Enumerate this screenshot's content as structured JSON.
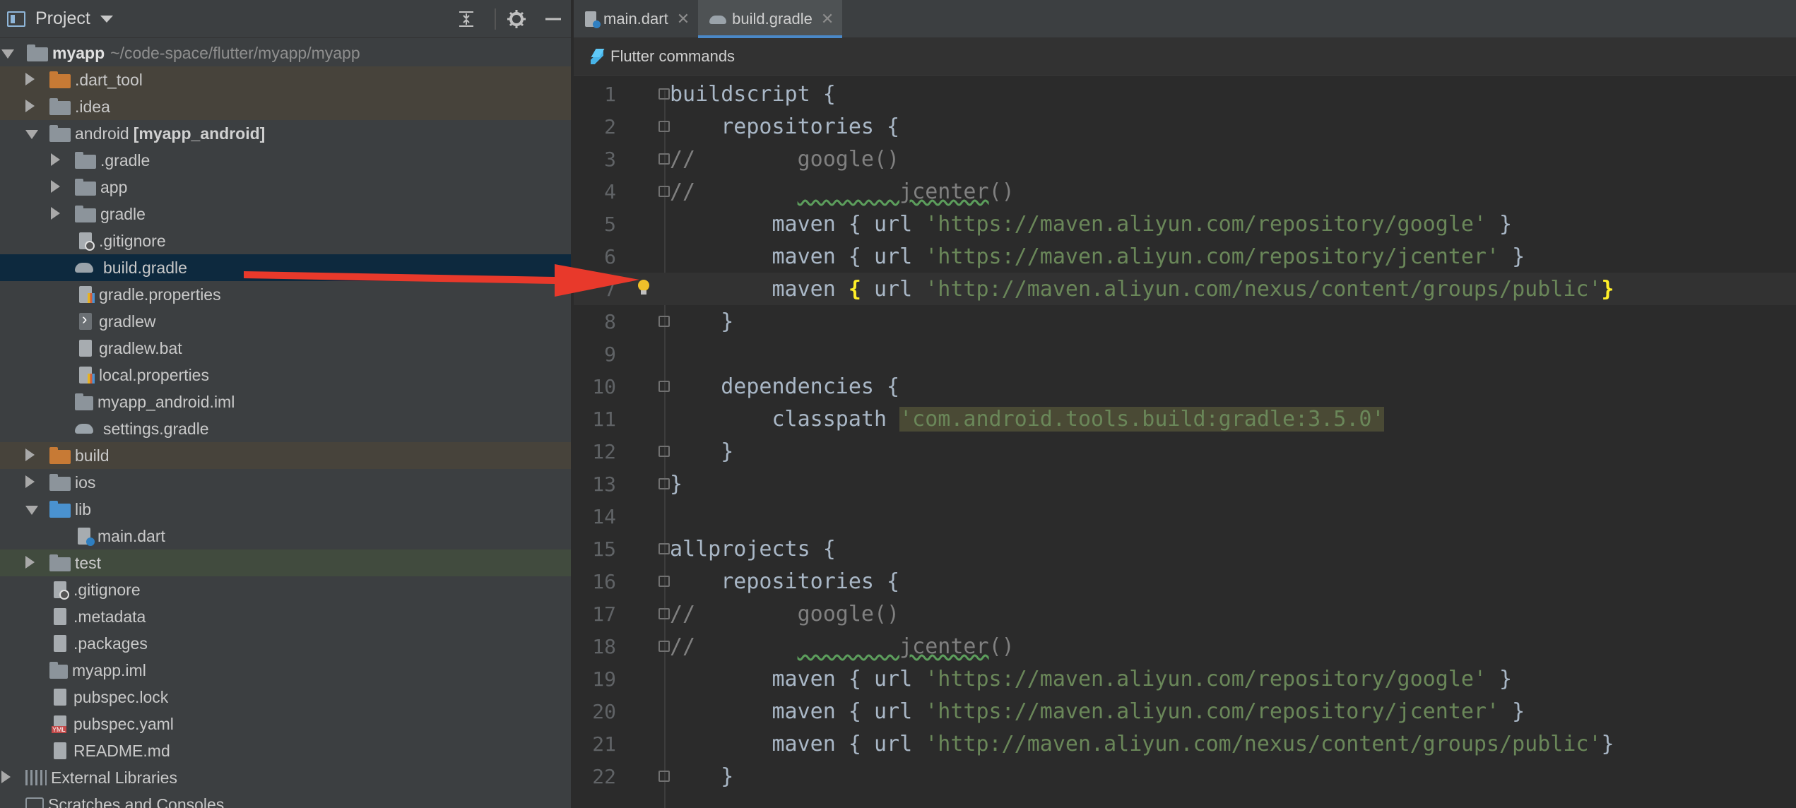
{
  "project_panel": {
    "title": "Project",
    "tree": [
      {
        "label": "myapp",
        "path": "~/code-space/flutter/myapp/myapp",
        "bold": true,
        "expanded": true
      },
      {
        "label": ".dart_tool"
      },
      {
        "label": ".idea"
      },
      {
        "label": "android",
        "module": "[myapp_android]"
      },
      {
        "label": ".gradle"
      },
      {
        "label": "app"
      },
      {
        "label": "gradle"
      },
      {
        "label": ".gitignore"
      },
      {
        "label": "build.gradle"
      },
      {
        "label": "gradle.properties"
      },
      {
        "label": "gradlew"
      },
      {
        "label": "gradlew.bat"
      },
      {
        "label": "local.properties"
      },
      {
        "label": "myapp_android.iml"
      },
      {
        "label": "settings.gradle"
      },
      {
        "label": "build"
      },
      {
        "label": "ios"
      },
      {
        "label": "lib"
      },
      {
        "label": "main.dart"
      },
      {
        "label": "test"
      },
      {
        "label": ".gitignore"
      },
      {
        "label": ".metadata"
      },
      {
        "label": ".packages"
      },
      {
        "label": "myapp.iml"
      },
      {
        "label": "pubspec.lock"
      },
      {
        "label": "pubspec.yaml"
      },
      {
        "label": "README.md"
      },
      {
        "label": "External Libraries"
      },
      {
        "label": "Scratches and Consoles"
      }
    ]
  },
  "editor": {
    "tabs": [
      {
        "label": "main.dart",
        "active": false
      },
      {
        "label": "build.gradle",
        "active": true
      }
    ],
    "flutter_bar": "Flutter commands",
    "line_numbers": [
      "1",
      "2",
      "3",
      "4",
      "5",
      "6",
      "7",
      "8",
      "9",
      "10",
      "11",
      "12",
      "13",
      "14",
      "15",
      "16",
      "17",
      "18",
      "19",
      "20",
      "21",
      "22"
    ],
    "code": {
      "l1": "buildscript {",
      "l2": "    repositories {",
      "l3_c": "//",
      "l3_t": "        google()",
      "l4_c": "//",
      "l4_t": "        jcenter",
      "l4_p": "()",
      "maven_kw": "maven",
      "url_kw": "url",
      "open_b": "{",
      "close_b": "}",
      "s_google": "'https://maven.aliyun.com/repository/google'",
      "s_jcenter": "'https://maven.aliyun.com/repository/jcenter'",
      "s_public": "'http://maven.aliyun.com/nexus/content/groups/public'",
      "l8": "    }",
      "l10": "    dependencies {",
      "l11_k": "        classpath ",
      "l11_s": "'com.android.tools.build:gradle:3.5.0'",
      "l12": "    }",
      "l13": "}",
      "l15": "allprojects {",
      "l16": "    repositories {",
      "l22": "    }"
    }
  },
  "colors": {
    "accent": "#4a88c7",
    "selection": "#0d293e",
    "arrow": "#e8392b",
    "string": "#6a8759",
    "brace_highlight": "#ffef28"
  }
}
